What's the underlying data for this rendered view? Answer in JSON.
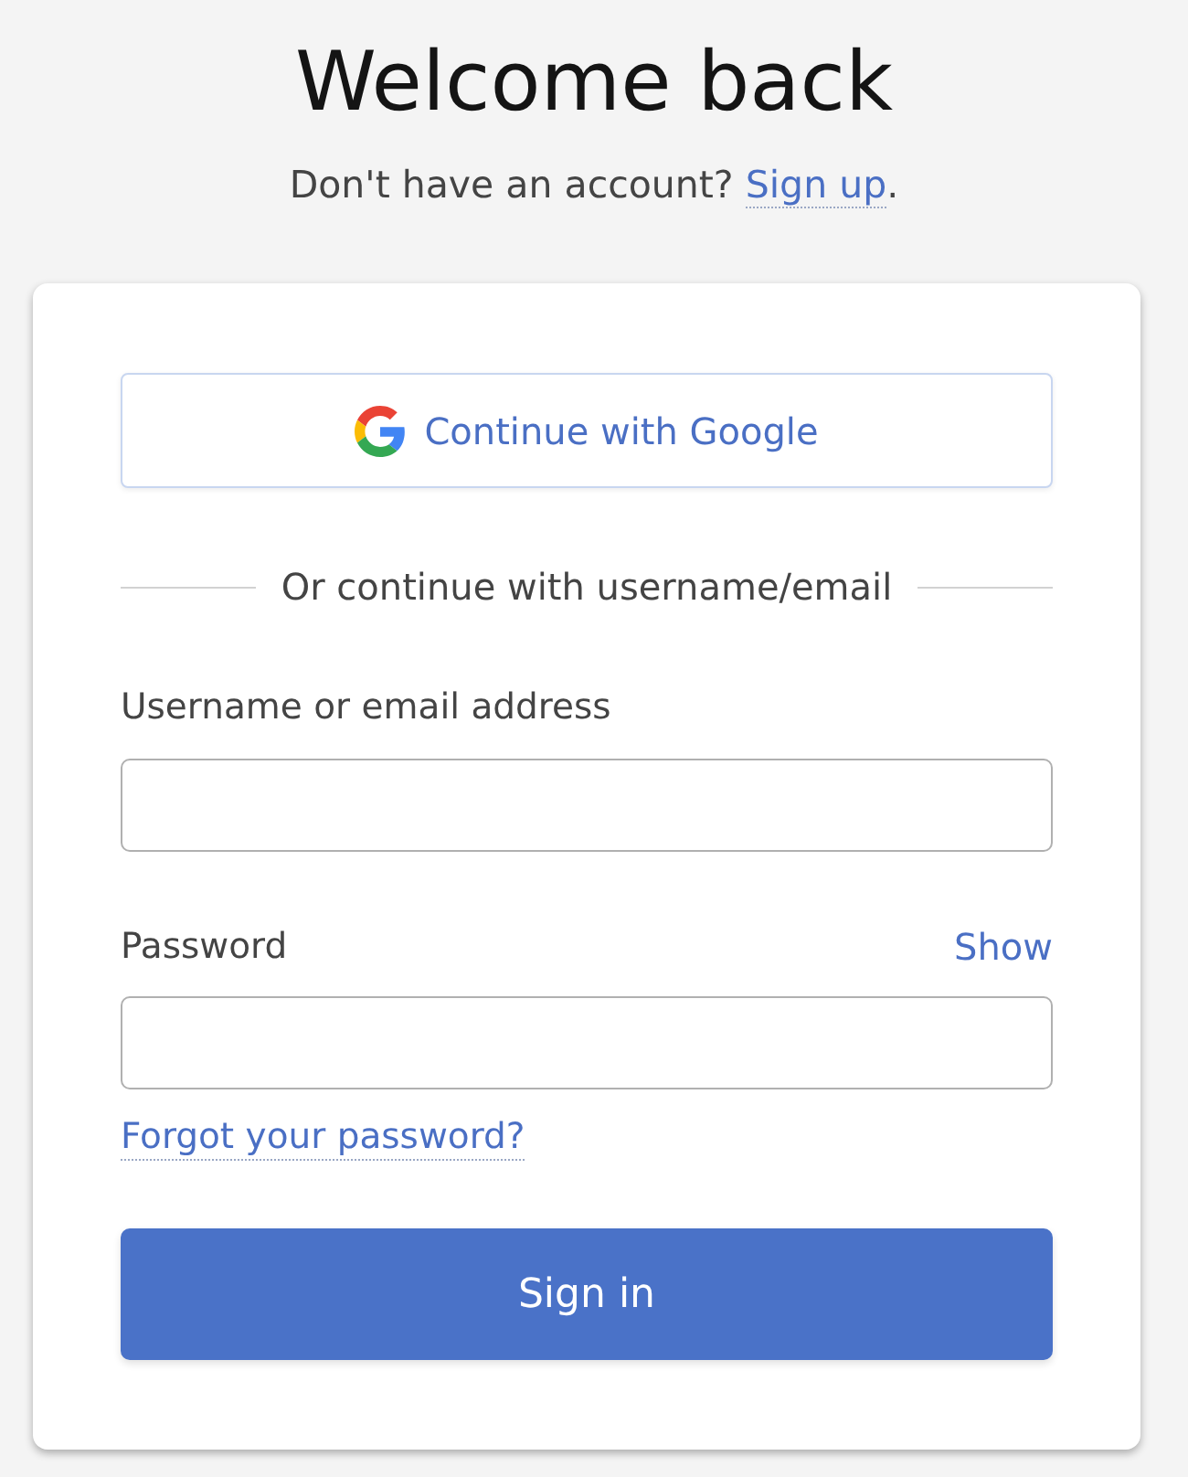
{
  "header": {
    "title": "Welcome back",
    "prompt": {
      "text": "Don't have an account?",
      "link": "Sign up",
      "after": "."
    }
  },
  "card": {
    "google_button": "Continue with Google",
    "divider": "Or continue with username/email",
    "fields": [
      {
        "label": "Username or email address"
      },
      {
        "label": "Password",
        "action": "Show"
      }
    ],
    "forgot_link": "Forgot your password?",
    "submit_button": "Sign in"
  }
}
